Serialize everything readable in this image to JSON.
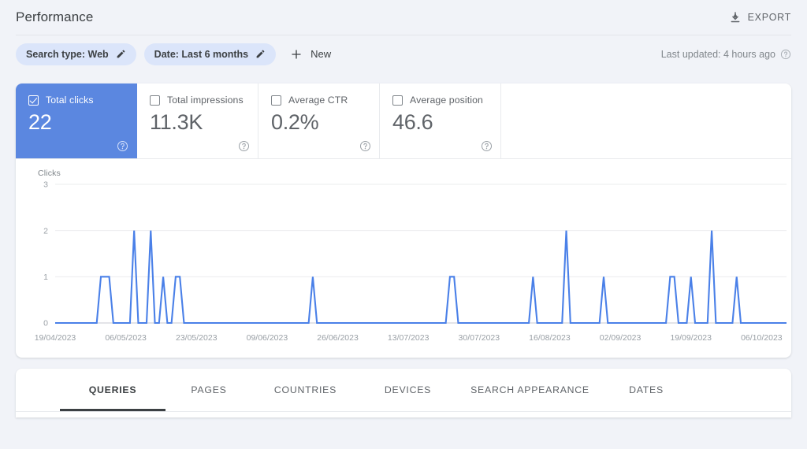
{
  "header": {
    "title": "Performance",
    "export_label": "EXPORT",
    "export_icon": "download-icon"
  },
  "filters": {
    "chips": [
      {
        "label": "Search type: Web",
        "edit_icon": "pencil-icon"
      },
      {
        "label": "Date: Last 6 months",
        "edit_icon": "pencil-icon"
      }
    ],
    "new_label": "New",
    "new_icon": "plus-icon",
    "last_updated": "Last updated: 4 hours ago",
    "help_icon": "help-circle-icon"
  },
  "metrics": [
    {
      "label": "Total clicks",
      "value": "22",
      "checked": true,
      "help_icon": "help-circle-icon"
    },
    {
      "label": "Total impressions",
      "value": "11.3K",
      "checked": false,
      "help_icon": "help-circle-icon"
    },
    {
      "label": "Average CTR",
      "value": "0.2%",
      "checked": false,
      "help_icon": "help-circle-icon"
    },
    {
      "label": "Average position",
      "value": "46.6",
      "checked": false,
      "help_icon": "help-circle-icon"
    }
  ],
  "tabs": [
    {
      "label": "QUERIES",
      "active": true
    },
    {
      "label": "PAGES",
      "active": false
    },
    {
      "label": "COUNTRIES",
      "active": false
    },
    {
      "label": "DEVICES",
      "active": false
    },
    {
      "label": "SEARCH APPEARANCE",
      "active": false
    },
    {
      "label": "DATES",
      "active": false
    }
  ],
  "colors": {
    "accent_blue": "#5b87e0",
    "line_blue": "#4a80e8",
    "page_bg": "#f1f3f8",
    "chip_bg": "#dbe5fa",
    "text_primary": "#3c4043",
    "text_secondary": "#5f6368",
    "text_muted": "#9aa0a6"
  },
  "chart_data": {
    "type": "line",
    "title": "",
    "ylabel": "Clicks",
    "xlabel": "",
    "ylim": [
      0,
      3
    ],
    "yticks": [
      0,
      1,
      2,
      3
    ],
    "grid": true,
    "legend": false,
    "x_tick_labels": [
      "19/04/2023",
      "06/05/2023",
      "23/05/2023",
      "09/06/2023",
      "26/06/2023",
      "13/07/2023",
      "30/07/2023",
      "16/08/2023",
      "02/09/2023",
      "19/09/2023",
      "06/10/2023"
    ],
    "x_tick_day_index": [
      0,
      17,
      34,
      51,
      68,
      85,
      102,
      119,
      136,
      153,
      170
    ],
    "x_start_date": "19/04/2023",
    "x_end_date": "12/10/2023",
    "n_days": 177,
    "series": [
      {
        "name": "Clicks",
        "color": "#4a80e8",
        "total": 22,
        "nonzero_points": [
          {
            "day_index": 11,
            "value": 1
          },
          {
            "day_index": 12,
            "value": 1
          },
          {
            "day_index": 13,
            "value": 1
          },
          {
            "day_index": 19,
            "value": 2
          },
          {
            "day_index": 23,
            "value": 2
          },
          {
            "day_index": 26,
            "value": 1
          },
          {
            "day_index": 29,
            "value": 1
          },
          {
            "day_index": 30,
            "value": 1
          },
          {
            "day_index": 62,
            "value": 1
          },
          {
            "day_index": 95,
            "value": 1
          },
          {
            "day_index": 96,
            "value": 1
          },
          {
            "day_index": 115,
            "value": 1
          },
          {
            "day_index": 123,
            "value": 2
          },
          {
            "day_index": 132,
            "value": 1
          },
          {
            "day_index": 148,
            "value": 1
          },
          {
            "day_index": 149,
            "value": 1
          },
          {
            "day_index": 153,
            "value": 1
          },
          {
            "day_index": 158,
            "value": 2
          },
          {
            "day_index": 164,
            "value": 1
          }
        ]
      }
    ]
  }
}
